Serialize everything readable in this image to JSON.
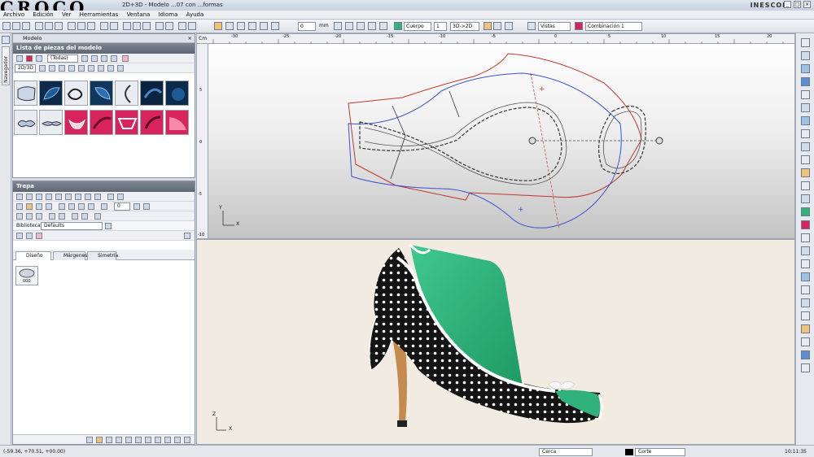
{
  "logo_text": "CROCO",
  "title": "2D+3D - Modelo ...07 con ...formas",
  "brand": "INESCOP",
  "menu": [
    "Archivo",
    "Edición",
    "Ver",
    "Herramientas",
    "Ventana",
    "Idioma",
    "Ayuda"
  ],
  "toolbar": {
    "units": "mm",
    "body_select": "Cuerpo",
    "body_count": "1",
    "view_mode": "3D->2D",
    "views": "Vistas",
    "combination": "Combinación 1",
    "zoom_value": "0"
  },
  "left_tab": "Navegador",
  "model_panel": {
    "tab_label": "Modelo",
    "section_title": "Lista de piezas del modelo",
    "filter": "(Todas)",
    "mode": "2D/3D"
  },
  "trepa_panel": {
    "section_title": "Trepa",
    "value": "0",
    "library_label": "Biblioteca",
    "library_value": "Defaults",
    "tabs": [
      "Diseño",
      "Márgenes",
      "Simetría"
    ],
    "item_label": "000"
  },
  "ruler": {
    "top_ticks": [
      "-30",
      "-25",
      "-20",
      "-15",
      "-10",
      "-5",
      "0",
      "5",
      "10",
      "15",
      "20"
    ],
    "left_ticks": [
      "5",
      "0",
      "-5",
      "-10"
    ],
    "corner": "Cm"
  },
  "axes_2d": {
    "y": "Y",
    "x": "X"
  },
  "axes_3d": {
    "z": "Z",
    "x": "X"
  },
  "status": {
    "coords": "(-59.36, +70.51, +00.00)",
    "snap": "Cerca",
    "layer": "Corte",
    "time": "10:11:35"
  },
  "colors": {
    "shoe_green": "#2fb37a",
    "polka_black": "#141414",
    "heel_wood": "#c48a4e",
    "outline_red": "#c0392b",
    "outline_blue": "#3b4fd1",
    "thumb_red": "#d8245c"
  }
}
